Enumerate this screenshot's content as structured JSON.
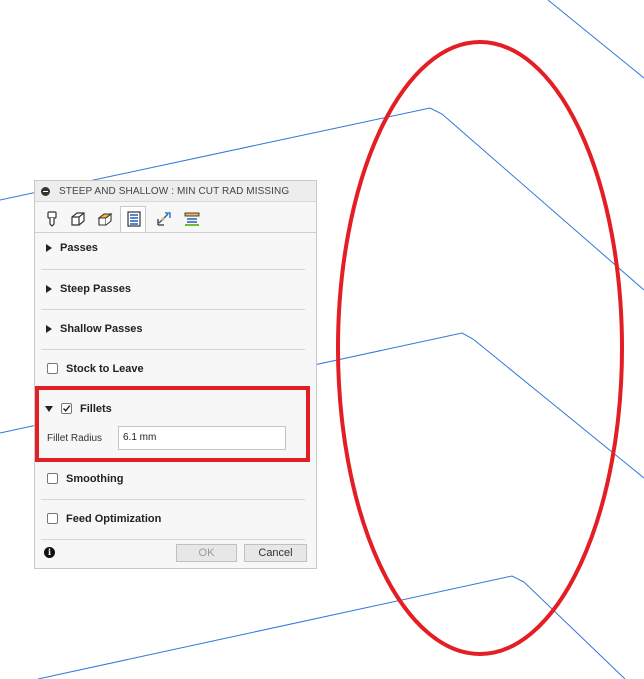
{
  "dialog": {
    "title": "STEEP AND SHALLOW : MIN CUT RAD MISSING",
    "tabs": [
      {
        "icon": "tool-icon",
        "active": false
      },
      {
        "icon": "geometry-icon",
        "active": false
      },
      {
        "icon": "heights-icon",
        "active": false
      },
      {
        "icon": "passes-icon",
        "active": true
      },
      {
        "icon": "linking-icon",
        "active": false
      },
      {
        "icon": "multiaxis-icon",
        "active": false
      }
    ],
    "sections": {
      "passes": "Passes",
      "steep_passes": "Steep Passes",
      "shallow_passes": "Shallow Passes",
      "stock_to_leave": "Stock to Leave",
      "fillets": "Fillets",
      "smoothing": "Smoothing",
      "feed_optimization": "Feed Optimization"
    },
    "fillets_checked": true,
    "fillet_radius": {
      "label": "Fillet Radius",
      "value": "6.1 mm"
    },
    "buttons": {
      "ok": "OK",
      "cancel": "Cancel"
    },
    "info_glyph": "i"
  },
  "colors": {
    "annotation_red": "#e31e24",
    "toolpath_blue": "#2e78d8"
  }
}
